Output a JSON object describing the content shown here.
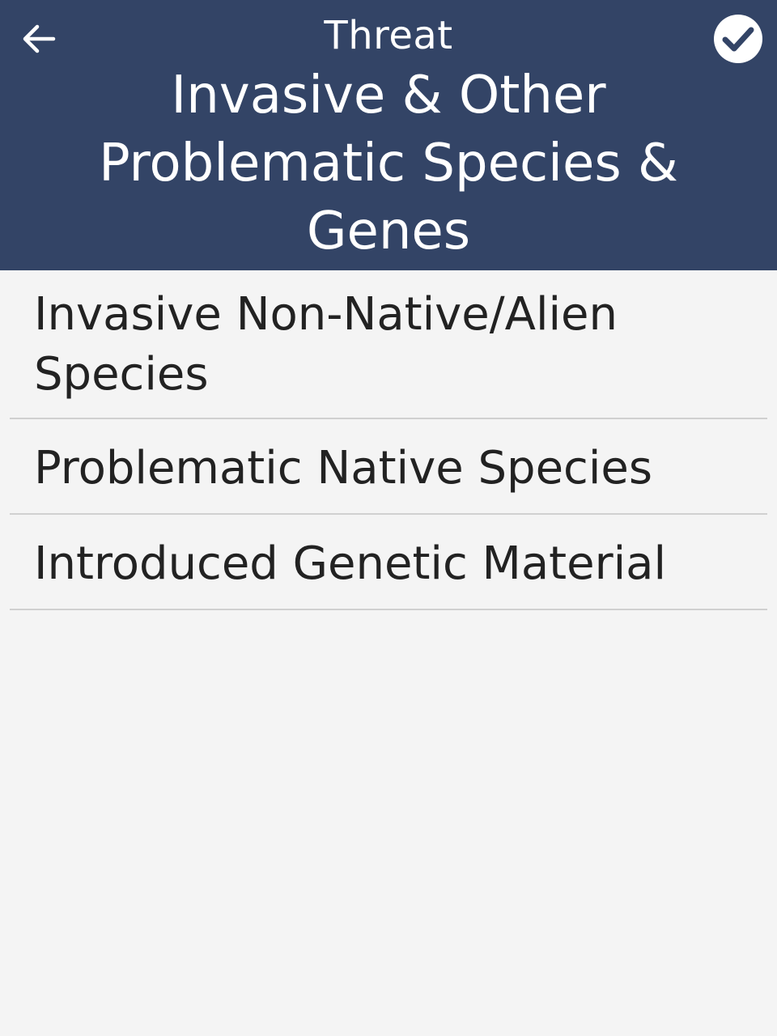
{
  "header": {
    "subtitle": "Threat",
    "title": "Invasive & Other Problematic Species & Genes",
    "back_icon": "arrow-left-icon",
    "confirm_icon": "check-circle-icon",
    "background_color": "#334466"
  },
  "list": {
    "items": [
      {
        "label": "Invasive Non-Native/Alien Species"
      },
      {
        "label": "Problematic Native Species"
      },
      {
        "label": "Introduced Genetic Material"
      }
    ]
  }
}
